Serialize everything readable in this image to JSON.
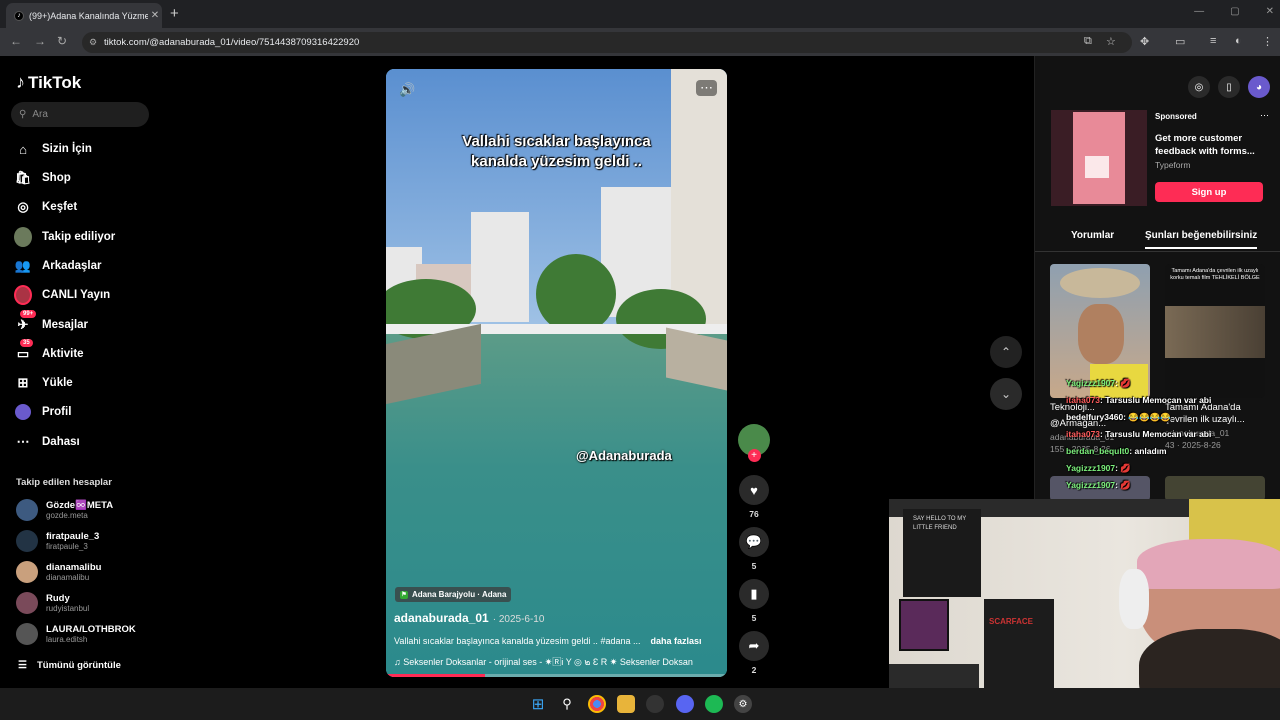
{
  "browser": {
    "tab_title": "(99+)Adana Kanalında Yüzme İ",
    "tab_close": "✕",
    "new_tab": "+",
    "url": "tiktok.com/@adanaburada_01/video/7514438709316422920"
  },
  "sidebar": {
    "logo": "TikTok",
    "search_placeholder": "Ara",
    "nav": [
      {
        "label": "Sizin İçin",
        "icon": "home-icon"
      },
      {
        "label": "Shop",
        "icon": "shop-icon"
      },
      {
        "label": "Keşfet",
        "icon": "compass-icon"
      },
      {
        "label": "Takip ediliyor",
        "icon": "following-avatar-icon"
      },
      {
        "label": "Arkadaşlar",
        "icon": "friends-icon"
      },
      {
        "label": "CANLI Yayın",
        "icon": "live-icon"
      },
      {
        "label": "Mesajlar",
        "icon": "messages-icon",
        "badge": "99+"
      },
      {
        "label": "Aktivite",
        "icon": "activity-icon",
        "badge": "35"
      },
      {
        "label": "Yükle",
        "icon": "upload-icon"
      },
      {
        "label": "Profil",
        "icon": "profile-icon"
      },
      {
        "label": "Dahası",
        "icon": "more-icon"
      }
    ],
    "following_title": "Takip edilen hesaplar",
    "following": [
      {
        "name": "Gözde♾️META",
        "handle": "gozde.meta"
      },
      {
        "name": "firatpaule_3",
        "handle": "firatpaule_3"
      },
      {
        "name": "dianamalibu",
        "handle": "dianamalibu"
      },
      {
        "name": "Rudy",
        "handle": "rudyistanbul"
      },
      {
        "name": "LAURA/LOTHBROK",
        "handle": "laura.editsh"
      }
    ],
    "see_all": "Tümünü görüntüle"
  },
  "video": {
    "caption_line1": "Vallahi sıcaklar başlayınca",
    "caption_line2": "kanalda yüzesim geldi ..",
    "watermark": "@Adanaburada",
    "location": "Adana Barajyolu · Adana",
    "author": "adanaburada_01",
    "date": "· 2025-6-10",
    "description": "Vallahi sıcaklar başlayınca kanalda yüzesim geldi .. #adana ...",
    "more_label": "daha fazlası",
    "music": "♫  Seksenler Doksanlar - orijinal ses - ✷🅁Ꭵ Y ◎ ๒ Ɛ R ✷  Seksenler Doksan",
    "progress": 0.29
  },
  "actions": {
    "likes": "76",
    "comments": "5",
    "saves": "5",
    "shares": "2"
  },
  "right_panel": {
    "ad_sponsored": "Sponsored",
    "ad_headline": "Get more customer feedback with forms...",
    "ad_brand": "Typeform",
    "ad_cta": "Sign up",
    "tab_comments": "Yorumlar",
    "tab_suggested": "Şunları beğenebilirsiniz",
    "card1_title": "Teknoloji...",
    "card1_title2": "@Armağan...",
    "card1_author": "adanaburada_01",
    "card1_meta": "155 · 2025-8-26",
    "card2_overlay": "Tamamı Adana'da çevrilen ilk uzaylı korku temalı film TEHLİKELİ BÖLGE",
    "card2_title": "Tamamı Adana'da çevrilen ilk uzaylı...",
    "card2_author": "adanaburada_01",
    "card2_meta": "43 · 2025-8-26"
  },
  "stream_chat": [
    {
      "user": "Yagizzz1907",
      "msg": ": 💋",
      "color": "#7cf07c"
    },
    {
      "user": "itaha073",
      "msg": ": Tarsuslu Memocan var abi",
      "color": "#ff5c5c"
    },
    {
      "user": "bedelfury3460",
      "msg": ": 😂😂😂😂",
      "color": "#ffffff"
    },
    {
      "user": "itaha073",
      "msg": ": Tarsuslu Memocan var abi",
      "color": "#ff5c5c"
    },
    {
      "user": "berdan_beqult0",
      "msg": ": anladım",
      "color": "#7cf07c"
    },
    {
      "user": "Yagizzz1907",
      "msg": ": 💋",
      "color": "#7cf07c"
    },
    {
      "user": "Yagizzz1907",
      "msg": ": 💋",
      "color": "#7cf07c"
    }
  ],
  "webcam_poster_text": "SAY HELLO TO MY LITTLE FRIEND",
  "webcam_poster2": "SCARFACE"
}
